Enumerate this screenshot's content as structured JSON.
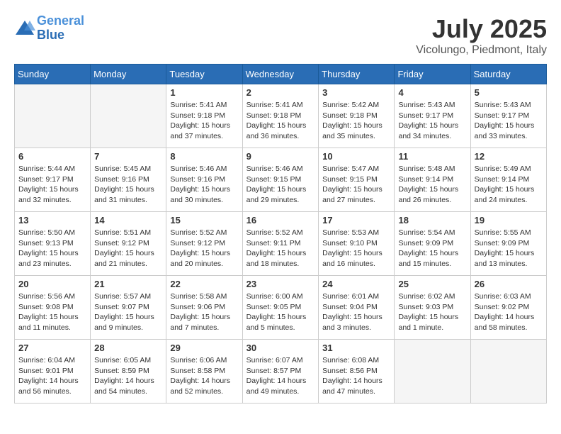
{
  "header": {
    "logo_line1": "General",
    "logo_line2": "Blue",
    "month": "July 2025",
    "location": "Vicolungo, Piedmont, Italy"
  },
  "weekdays": [
    "Sunday",
    "Monday",
    "Tuesday",
    "Wednesday",
    "Thursday",
    "Friday",
    "Saturday"
  ],
  "weeks": [
    [
      {
        "day": "",
        "info": ""
      },
      {
        "day": "",
        "info": ""
      },
      {
        "day": "1",
        "info": "Sunrise: 5:41 AM\nSunset: 9:18 PM\nDaylight: 15 hours\nand 37 minutes."
      },
      {
        "day": "2",
        "info": "Sunrise: 5:41 AM\nSunset: 9:18 PM\nDaylight: 15 hours\nand 36 minutes."
      },
      {
        "day": "3",
        "info": "Sunrise: 5:42 AM\nSunset: 9:18 PM\nDaylight: 15 hours\nand 35 minutes."
      },
      {
        "day": "4",
        "info": "Sunrise: 5:43 AM\nSunset: 9:17 PM\nDaylight: 15 hours\nand 34 minutes."
      },
      {
        "day": "5",
        "info": "Sunrise: 5:43 AM\nSunset: 9:17 PM\nDaylight: 15 hours\nand 33 minutes."
      }
    ],
    [
      {
        "day": "6",
        "info": "Sunrise: 5:44 AM\nSunset: 9:17 PM\nDaylight: 15 hours\nand 32 minutes."
      },
      {
        "day": "7",
        "info": "Sunrise: 5:45 AM\nSunset: 9:16 PM\nDaylight: 15 hours\nand 31 minutes."
      },
      {
        "day": "8",
        "info": "Sunrise: 5:46 AM\nSunset: 9:16 PM\nDaylight: 15 hours\nand 30 minutes."
      },
      {
        "day": "9",
        "info": "Sunrise: 5:46 AM\nSunset: 9:15 PM\nDaylight: 15 hours\nand 29 minutes."
      },
      {
        "day": "10",
        "info": "Sunrise: 5:47 AM\nSunset: 9:15 PM\nDaylight: 15 hours\nand 27 minutes."
      },
      {
        "day": "11",
        "info": "Sunrise: 5:48 AM\nSunset: 9:14 PM\nDaylight: 15 hours\nand 26 minutes."
      },
      {
        "day": "12",
        "info": "Sunrise: 5:49 AM\nSunset: 9:14 PM\nDaylight: 15 hours\nand 24 minutes."
      }
    ],
    [
      {
        "day": "13",
        "info": "Sunrise: 5:50 AM\nSunset: 9:13 PM\nDaylight: 15 hours\nand 23 minutes."
      },
      {
        "day": "14",
        "info": "Sunrise: 5:51 AM\nSunset: 9:12 PM\nDaylight: 15 hours\nand 21 minutes."
      },
      {
        "day": "15",
        "info": "Sunrise: 5:52 AM\nSunset: 9:12 PM\nDaylight: 15 hours\nand 20 minutes."
      },
      {
        "day": "16",
        "info": "Sunrise: 5:52 AM\nSunset: 9:11 PM\nDaylight: 15 hours\nand 18 minutes."
      },
      {
        "day": "17",
        "info": "Sunrise: 5:53 AM\nSunset: 9:10 PM\nDaylight: 15 hours\nand 16 minutes."
      },
      {
        "day": "18",
        "info": "Sunrise: 5:54 AM\nSunset: 9:09 PM\nDaylight: 15 hours\nand 15 minutes."
      },
      {
        "day": "19",
        "info": "Sunrise: 5:55 AM\nSunset: 9:09 PM\nDaylight: 15 hours\nand 13 minutes."
      }
    ],
    [
      {
        "day": "20",
        "info": "Sunrise: 5:56 AM\nSunset: 9:08 PM\nDaylight: 15 hours\nand 11 minutes."
      },
      {
        "day": "21",
        "info": "Sunrise: 5:57 AM\nSunset: 9:07 PM\nDaylight: 15 hours\nand 9 minutes."
      },
      {
        "day": "22",
        "info": "Sunrise: 5:58 AM\nSunset: 9:06 PM\nDaylight: 15 hours\nand 7 minutes."
      },
      {
        "day": "23",
        "info": "Sunrise: 6:00 AM\nSunset: 9:05 PM\nDaylight: 15 hours\nand 5 minutes."
      },
      {
        "day": "24",
        "info": "Sunrise: 6:01 AM\nSunset: 9:04 PM\nDaylight: 15 hours\nand 3 minutes."
      },
      {
        "day": "25",
        "info": "Sunrise: 6:02 AM\nSunset: 9:03 PM\nDaylight: 15 hours\nand 1 minute."
      },
      {
        "day": "26",
        "info": "Sunrise: 6:03 AM\nSunset: 9:02 PM\nDaylight: 14 hours\nand 58 minutes."
      }
    ],
    [
      {
        "day": "27",
        "info": "Sunrise: 6:04 AM\nSunset: 9:01 PM\nDaylight: 14 hours\nand 56 minutes."
      },
      {
        "day": "28",
        "info": "Sunrise: 6:05 AM\nSunset: 8:59 PM\nDaylight: 14 hours\nand 54 minutes."
      },
      {
        "day": "29",
        "info": "Sunrise: 6:06 AM\nSunset: 8:58 PM\nDaylight: 14 hours\nand 52 minutes."
      },
      {
        "day": "30",
        "info": "Sunrise: 6:07 AM\nSunset: 8:57 PM\nDaylight: 14 hours\nand 49 minutes."
      },
      {
        "day": "31",
        "info": "Sunrise: 6:08 AM\nSunset: 8:56 PM\nDaylight: 14 hours\nand 47 minutes."
      },
      {
        "day": "",
        "info": ""
      },
      {
        "day": "",
        "info": ""
      }
    ]
  ]
}
